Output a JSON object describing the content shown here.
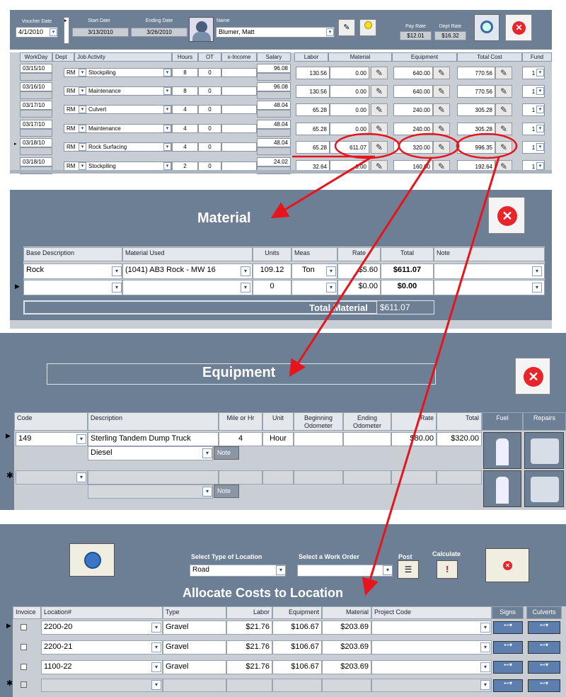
{
  "voucher": {
    "date_label": "Voucher Date",
    "date_value": "4/1/2010",
    "start_label": "Start Date",
    "start_value": "3/13/2010",
    "end_label": "Ending Date",
    "end_value": "3/26/2010",
    "name_label": "Name",
    "name_value": "Blumer, Matt",
    "pay_rate_label": "Pay Rate",
    "pay_rate_value": "$12.01",
    "dept_rate_label": "Dept Rate",
    "dept_rate_value": "$16.32"
  },
  "timesheet": {
    "headers": [
      "WorkDay",
      "Dept",
      "Job Activity",
      "Hours",
      "OT",
      "x-Income",
      "Salary",
      "Labor",
      "Material",
      "Equipment",
      "Total Cost",
      "Fund"
    ],
    "rows": [
      {
        "day": "03/15/10",
        "dept": "RM",
        "activity": "Stockpiling",
        "hours": "8",
        "ot": "0",
        "salary": "96.08",
        "labor": "130.56",
        "material": "0.00",
        "equipment": "640.00",
        "total": "770.56",
        "fund": "1"
      },
      {
        "day": "03/16/10",
        "dept": "RM",
        "activity": "Maintenance",
        "hours": "8",
        "ot": "0",
        "salary": "96.08",
        "labor": "130.56",
        "material": "0.00",
        "equipment": "640.00",
        "total": "770.56",
        "fund": "1"
      },
      {
        "day": "03/17/10",
        "dept": "RM",
        "activity": "Culvert",
        "hours": "4",
        "ot": "0",
        "salary": "48.04",
        "labor": "65.28",
        "material": "0.00",
        "equipment": "240.00",
        "total": "305.28",
        "fund": "1"
      },
      {
        "day": "03/17/10",
        "dept": "RM",
        "activity": "Maintenance",
        "hours": "4",
        "ot": "0",
        "salary": "48.04",
        "labor": "65.28",
        "material": "0.00",
        "equipment": "240.00",
        "total": "305.28",
        "fund": "1"
      },
      {
        "day": "03/18/10",
        "dept": "RM",
        "activity": "Rock Surfacing",
        "hours": "4",
        "ot": "0",
        "salary": "48.04",
        "labor": "65.28",
        "material": "611.07",
        "equipment": "320.00",
        "total": "996.35",
        "fund": "1"
      },
      {
        "day": "03/18/10",
        "dept": "RM",
        "activity": "Stockpiling",
        "hours": "2",
        "ot": "0",
        "salary": "24.02",
        "labor": "32.64",
        "material": "0.00",
        "equipment": "160.00",
        "total": "192.64",
        "fund": "1"
      }
    ]
  },
  "material": {
    "title": "Material",
    "headers": [
      "Base Description",
      "Material Used",
      "Units",
      "Meas",
      "Rate",
      "Total",
      "Note"
    ],
    "rows": [
      {
        "base": "Rock",
        "used": "(1041) AB3 Rock - MW 16",
        "units": "109.12",
        "meas": "Ton",
        "rate": "$5.60",
        "total": "$611.07"
      },
      {
        "base": "",
        "used": "",
        "units": "0",
        "meas": "",
        "rate": "$0.00",
        "total": "$0.00"
      }
    ],
    "total_label": "Total Material",
    "total_value": "$611.07"
  },
  "equipment": {
    "title": "Equipment",
    "headers": [
      "Code",
      "Description",
      "Mile or Hr",
      "Unit",
      "Beginning Odometer",
      "Ending Odometer",
      "Rate",
      "Total",
      "Fuel",
      "Repairs"
    ],
    "row": {
      "code": "149",
      "description": "Sterling Tandem Dump Truck",
      "miles": "4",
      "unit": "Hour",
      "rate": "$80.00",
      "total": "$320.00",
      "fuel": "Diesel",
      "note": "Note"
    },
    "new_note": "Note"
  },
  "allocate": {
    "title": "Allocate Costs to Location",
    "loc_type_label": "Select Type of Location",
    "loc_type_value": "Road",
    "work_order_label": "Select a Work Order",
    "post_label": "Post",
    "calc_label": "Calculate",
    "headers": [
      "Invoice",
      "Location#",
      "Type",
      "Labor",
      "Equipment",
      "Material",
      "Project Code",
      "Signs",
      "Culverts"
    ],
    "rows": [
      {
        "loc": "2200-20",
        "type": "Gravel",
        "labor": "$21.76",
        "equip": "$106.67",
        "mat": "$203.69"
      },
      {
        "loc": "2200-21",
        "type": "Gravel",
        "labor": "$21.76",
        "equip": "$106.67",
        "mat": "$203.69"
      },
      {
        "loc": "1100-22",
        "type": "Gravel",
        "labor": "$21.76",
        "equip": "$106.67",
        "mat": "$203.69"
      }
    ]
  },
  "colors": {
    "slate": "#6d7f95",
    "annotation": "#e8141c"
  }
}
